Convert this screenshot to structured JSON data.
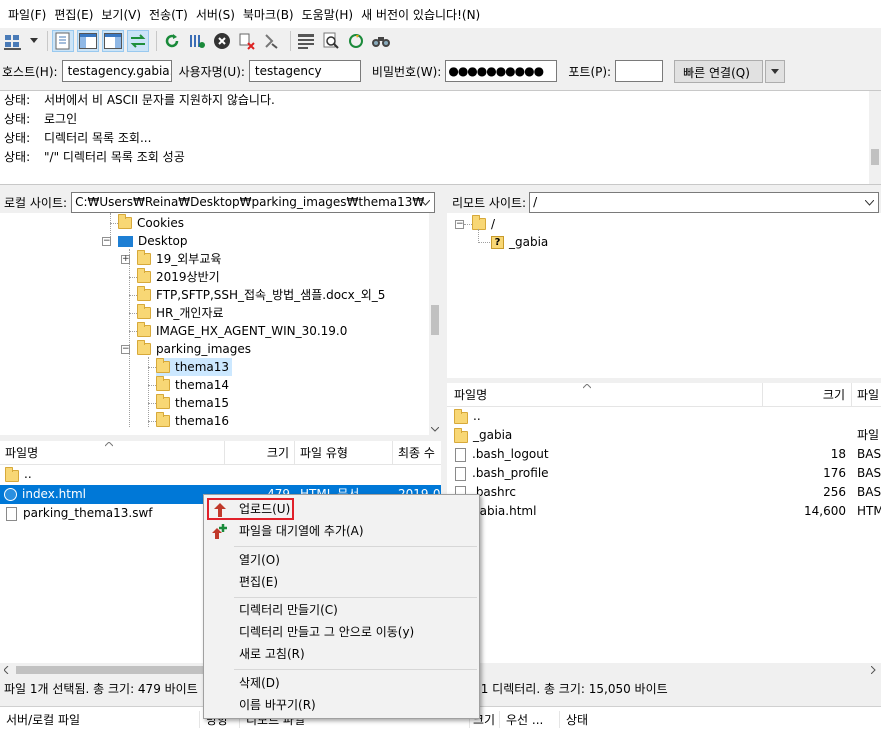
{
  "menubar": {
    "items": [
      "파일(F)",
      "편집(E)",
      "보기(V)",
      "전송(T)",
      "서버(S)",
      "북마크(B)",
      "도움말(H)",
      "새 버전이 있습니다!(N)"
    ]
  },
  "toolbar": {
    "icons": [
      "site-manager-icon",
      "dropdown-arrow-icon",
      "toggle-log-icon",
      "toggle-local-tree-icon",
      "toggle-remote-tree-icon",
      "toggle-queue-icon",
      "refresh-icon",
      "process-queue-icon",
      "cancel-icon",
      "disconnect-icon",
      "reconnect-icon",
      "filter-icon",
      "search-remote-icon",
      "sync-browse-icon",
      "compare-icon"
    ]
  },
  "quickconnect": {
    "host_label": "호스트(H):",
    "host_value": "testagency.gabia.io",
    "user_label": "사용자명(U):",
    "user_value": "testagency",
    "pass_label": "비밀번호(W):",
    "pass_value": "●●●●●●●●●●",
    "port_label": "포트(P):",
    "port_value": "",
    "connect_label": "빠른 연결(Q)"
  },
  "log": [
    {
      "type": "상태:",
      "msg": "서버에서 비 ASCII 문자를 지원하지 않습니다."
    },
    {
      "type": "상태:",
      "msg": "로그인"
    },
    {
      "type": "상태:",
      "msg": "디렉터리 목록 조회..."
    },
    {
      "type": "상태:",
      "msg": "\"/\" 디렉터리 목록 조회 성공"
    }
  ],
  "local": {
    "site_label": "로컬 사이트:",
    "path": "C:₩Users₩Reina₩Desktop₩parking_images₩thema13₩",
    "tree": [
      "Cookies",
      "Desktop",
      "19_외부교육",
      "2019상반기",
      "FTP,SFTP,SSH_접속_방법_샘플.docx_외_5",
      "HR_개인자료",
      "IMAGE_HX_AGENT_WIN_30.19.0",
      "parking_images",
      "thema13",
      "thema14",
      "thema15",
      "thema16"
    ],
    "columns": [
      "파일명",
      "크기",
      "파일 유형",
      "최종 수"
    ],
    "files": [
      {
        "name": "..",
        "size": "",
        "type": "",
        "date": ""
      },
      {
        "name": "index.html",
        "size": "479",
        "type": "HTML 문서",
        "date": "2019-0"
      },
      {
        "name": "parking_thema13.swf",
        "size": "",
        "type": "",
        "date": ""
      }
    ],
    "status": "파일 1개 선택됨. 총 크기: 479 바이트"
  },
  "remote": {
    "site_label": "리모트 사이트:",
    "path": "/",
    "tree": [
      "/",
      "_gabia"
    ],
    "columns": [
      "파일명",
      "크기",
      "파일"
    ],
    "files": [
      {
        "name": "..",
        "size": "",
        "type": ""
      },
      {
        "name": "_gabia",
        "size": "",
        "type": "파일"
      },
      {
        "name": ".bash_logout",
        "size": "18",
        "type": "BAS"
      },
      {
        "name": ".bash_profile",
        "size": "176",
        "type": "BAS"
      },
      {
        "name": ".bashrc",
        "size": "256",
        "type": "BAS"
      },
      {
        "name": "gabia.html",
        "size": "14,600",
        "type": "HTM"
      }
    ],
    "status": "일 및 1 디렉터리. 총 크기: 15,050 바이트"
  },
  "queue": {
    "columns": [
      "서버/로컬 파일",
      "방향",
      "리모트 파일",
      "크기",
      "우선 ...",
      "상태"
    ]
  },
  "context_menu": {
    "upload": "업로드(U)",
    "add_queue": "파일을 대기열에 추가(A)",
    "open": "열기(O)",
    "edit": "편집(E)",
    "mkdir": "디렉터리 만들기(C)",
    "mkdir_enter": "디렉터리 만들고 그 안으로 이동(y)",
    "refresh": "새로 고침(R)",
    "delete": "삭제(D)",
    "rename": "이름 바꾸기(R)"
  },
  "colors": {
    "selection": "#cce8ff",
    "highlight_border": "#e0202a",
    "upload_arrow": "#c0392b"
  }
}
